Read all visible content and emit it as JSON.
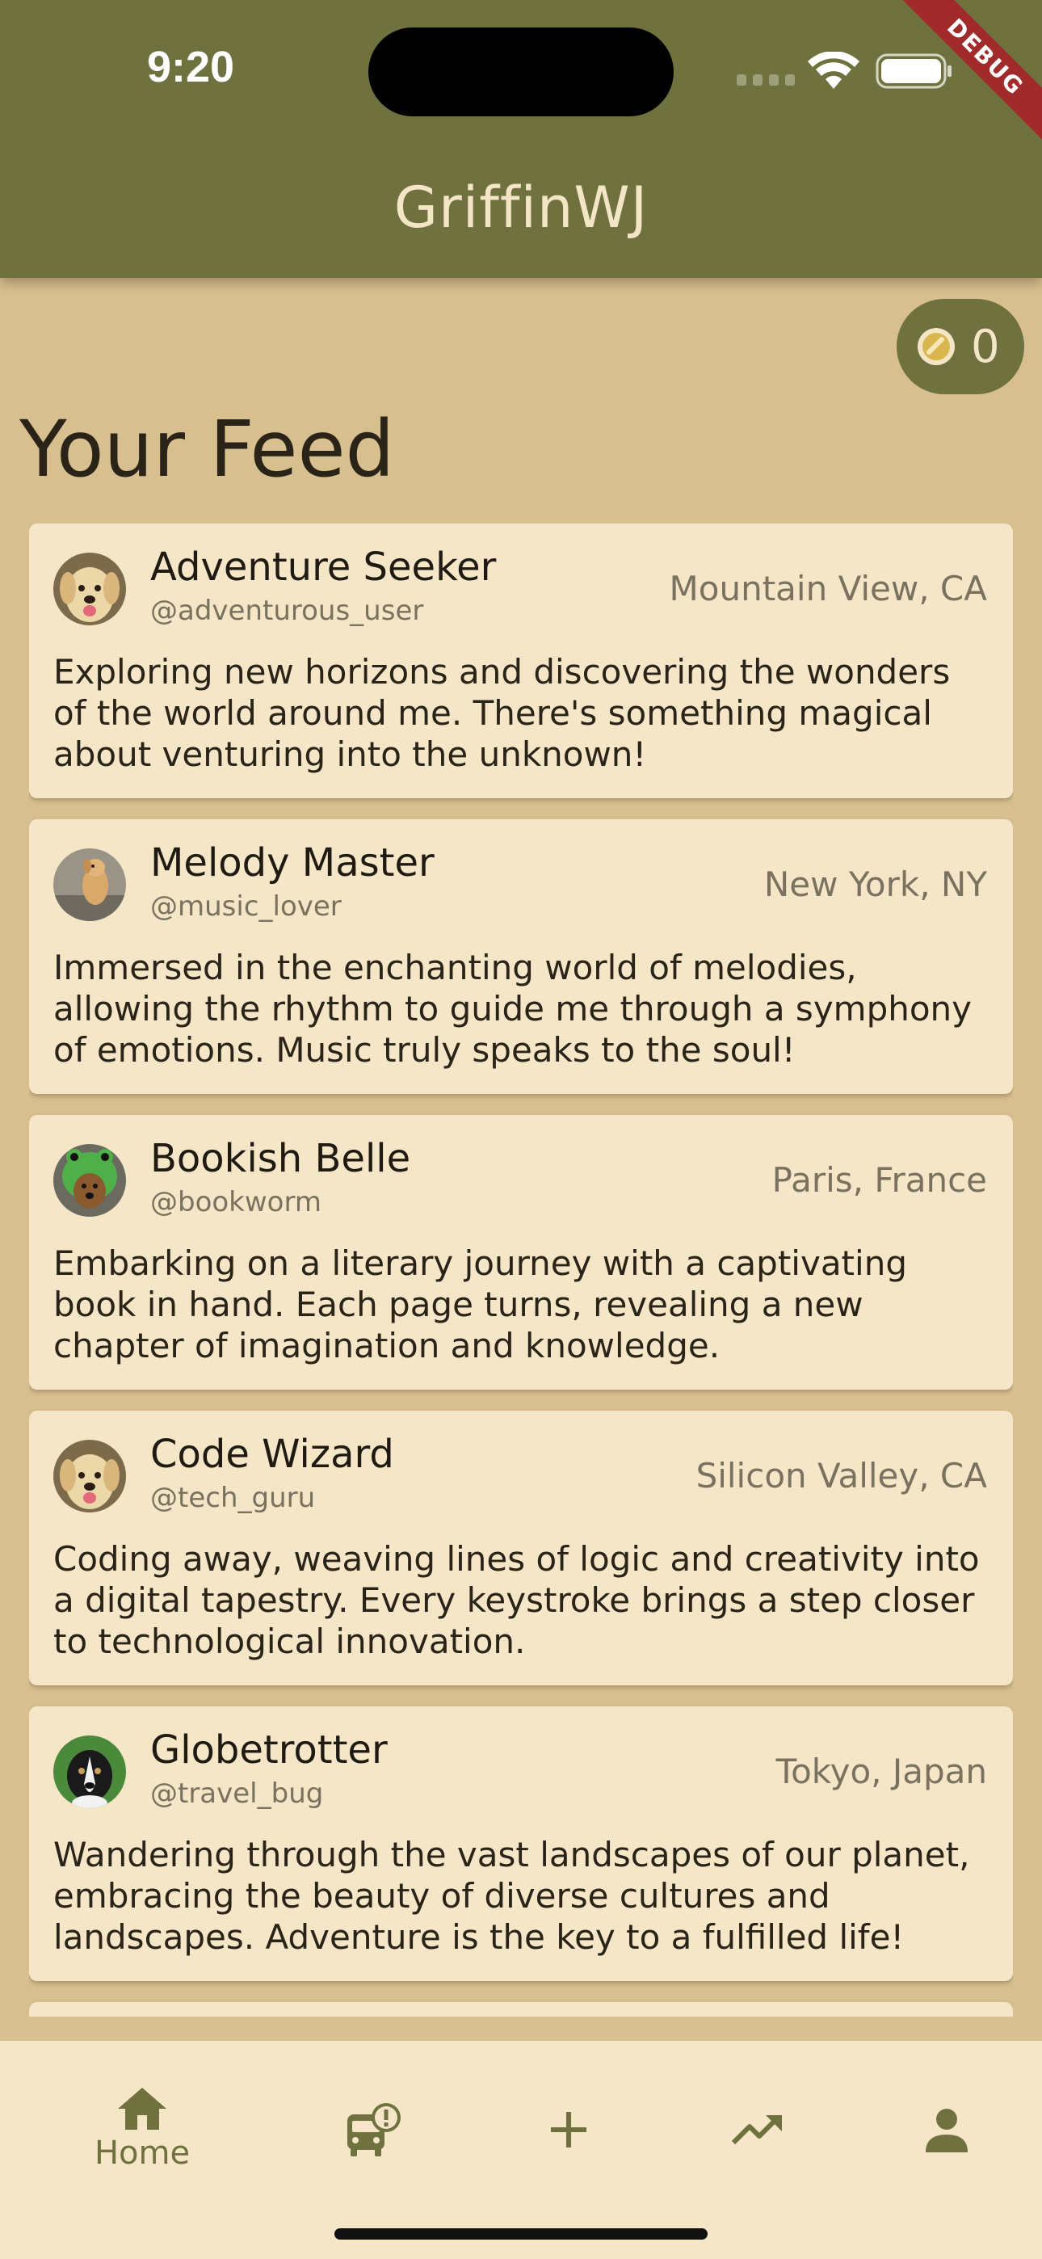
{
  "status_bar": {
    "time": "9:20"
  },
  "debug_banner": "DEBUG",
  "app_bar": {
    "title": "GriffinWJ"
  },
  "coins": {
    "count": "0",
    "icon": "coin-icon"
  },
  "feed": {
    "title": "Your Feed",
    "posts": [
      {
        "name": "Adventure Seeker",
        "handle": "@adventurous_user",
        "location": "Mountain View, CA",
        "text": "Exploring new horizons and discovering the wonders of the world around me. There's something magical about venturing into the unknown!",
        "avatar": "golden-retriever-avatar"
      },
      {
        "name": "Melody Master",
        "handle": "@music_lover",
        "location": "New York, NY",
        "text": "Immersed in the enchanting world of melodies, allowing the rhythm to guide me through a symphony of emotions. Music truly speaks to the soul!",
        "avatar": "dog-on-rock-avatar"
      },
      {
        "name": "Bookish Belle",
        "handle": "@bookworm",
        "location": "Paris, France",
        "text": "Embarking on a literary journey with a captivating book in hand. Each page turns, revealing a new chapter of imagination and knowledge.",
        "avatar": "frog-hat-dog-avatar"
      },
      {
        "name": "Code Wizard",
        "handle": "@tech_guru",
        "location": "Silicon Valley, CA",
        "text": "Coding away, weaving lines of logic and creativity into a digital tapestry. Every keystroke brings a step closer to technological innovation.",
        "avatar": "golden-retriever-avatar"
      },
      {
        "name": "Globetrotter",
        "handle": "@travel_bug",
        "location": "Tokyo, Japan",
        "text": "Wandering through the vast landscapes of our planet, embracing the beauty of diverse cultures and landscapes. Adventure is the key to a fulfilled life!",
        "avatar": "border-collie-avatar"
      }
    ]
  },
  "bottom_nav": {
    "items": [
      {
        "label": "Home",
        "icon": "home-icon",
        "selected": true
      },
      {
        "label": "",
        "icon": "bus-alert-icon"
      },
      {
        "label": "",
        "icon": "add-icon"
      },
      {
        "label": "",
        "icon": "trending-up-icon"
      },
      {
        "label": "",
        "icon": "person-icon"
      }
    ]
  },
  "colors": {
    "app_bar": "#6f723f",
    "background": "#d8bf8f",
    "card": "#f5e6c8",
    "accent_text": "#f3e5c6"
  }
}
